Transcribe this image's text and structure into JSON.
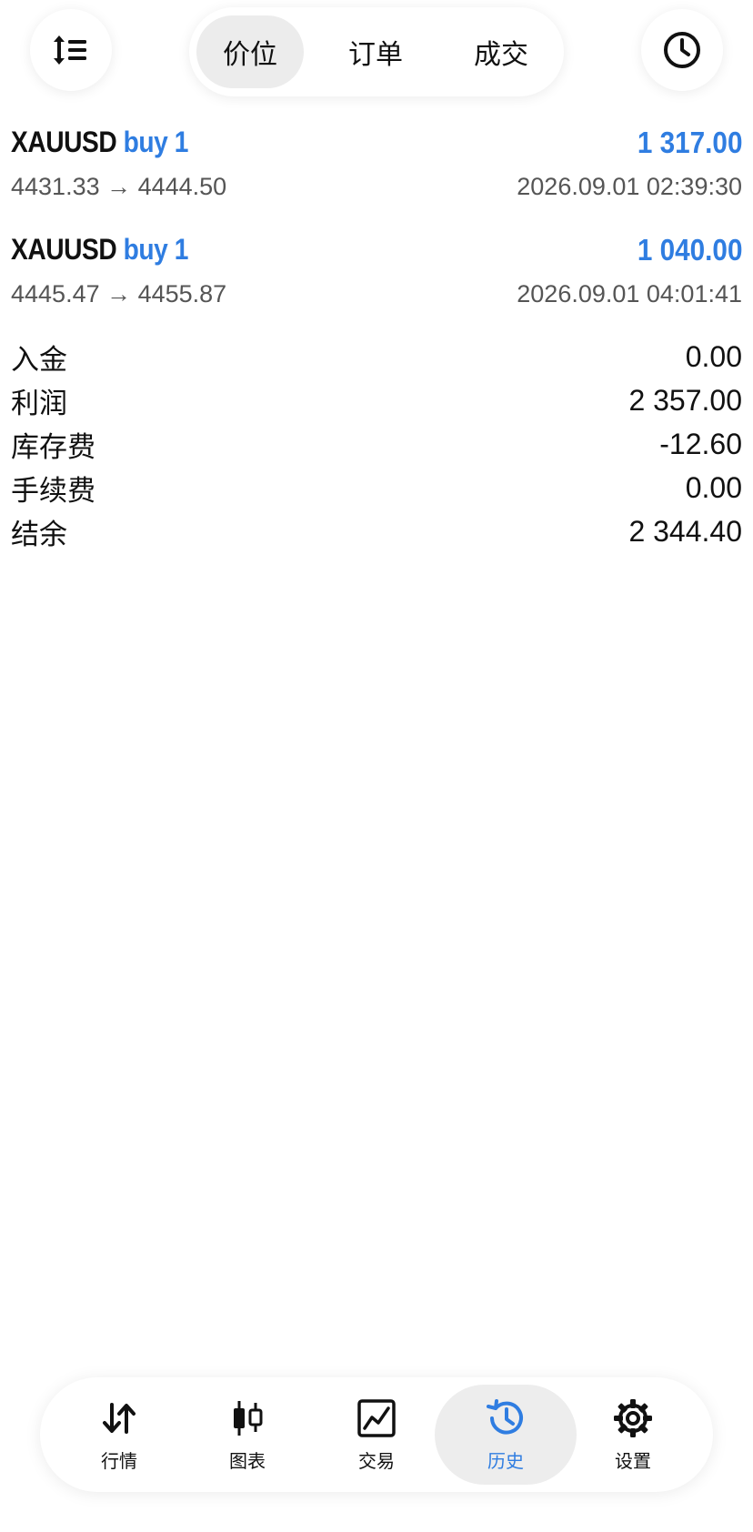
{
  "topbar": {
    "sort_icon": "sort-list-icon",
    "clock_icon": "clock-icon",
    "tabs": [
      {
        "label": "价位",
        "active": true
      },
      {
        "label": "订单",
        "active": false
      },
      {
        "label": "成交",
        "active": false
      }
    ]
  },
  "deals": [
    {
      "symbol": "XAUUSD",
      "side": "buy 1",
      "profit": "1 317.00",
      "prices": "4431.33 → 4444.50",
      "time": "2026.09.01 02:39:30"
    },
    {
      "symbol": "XAUUSD",
      "side": "buy 1",
      "profit": "1 040.00",
      "prices": "4445.47 → 4455.87",
      "time": "2026.09.01 04:01:41"
    }
  ],
  "summary": [
    {
      "label": "入金",
      "value": "0.00"
    },
    {
      "label": "利润",
      "value": "2 357.00"
    },
    {
      "label": "库存费",
      "value": "-12.60"
    },
    {
      "label": "手续费",
      "value": "0.00"
    },
    {
      "label": "结余",
      "value": "2 344.40"
    }
  ],
  "nav": [
    {
      "label": "行情",
      "icon": "quotes-arrows-icon",
      "active": false
    },
    {
      "label": "图表",
      "icon": "candlestick-chart-icon",
      "active": false
    },
    {
      "label": "交易",
      "icon": "trade-line-chart-icon",
      "active": false
    },
    {
      "label": "历史",
      "icon": "history-clock-icon",
      "active": true
    },
    {
      "label": "设置",
      "icon": "settings-gear-icon",
      "active": false
    }
  ],
  "colors": {
    "accent": "#2f7de1",
    "text": "#111111",
    "secondary_text": "#555555",
    "active_pill": "#ececec"
  }
}
